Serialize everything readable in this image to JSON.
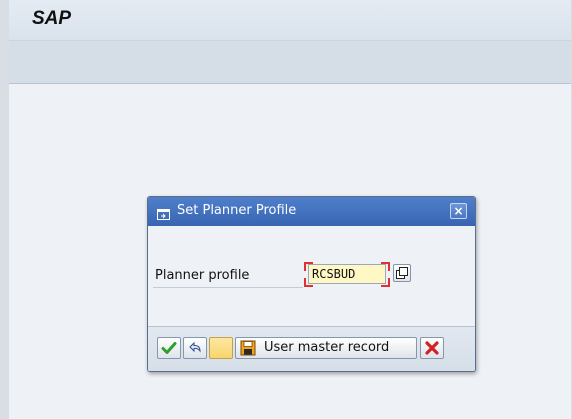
{
  "app": {
    "title": "SAP"
  },
  "dialog": {
    "title": "Set Planner Profile",
    "close_label": "×",
    "field_label": "Planner profile",
    "field_value": "RCSBUD",
    "user_master_record_label": "User master record"
  },
  "colors": {
    "dialog_title_bar": "#3f6fbf",
    "input_background": "#fff7c4",
    "required_marker": "#e03030",
    "confirm_green": "#2e9e2e",
    "cancel_red": "#d42020"
  },
  "icons": {
    "title_icon": "dialog-window-icon",
    "close": "close-icon",
    "copy": "copy-value-icon",
    "confirm": "checkmark-icon",
    "undo": "undo-icon",
    "save": "save-icon",
    "cancel": "cancel-icon"
  }
}
